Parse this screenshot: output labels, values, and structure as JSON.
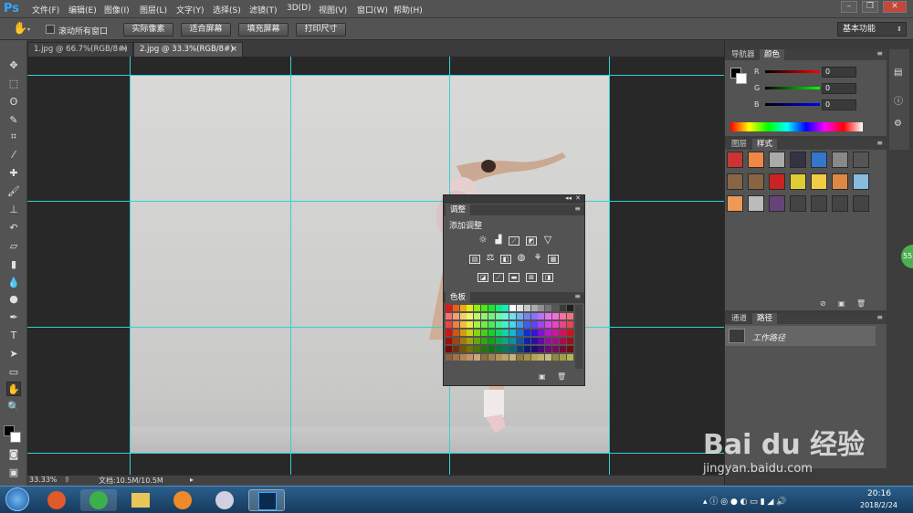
{
  "app": {
    "logo": "Ps",
    "accent": "#31a8ff"
  },
  "menu": [
    "文件(F)",
    "编辑(E)",
    "图像(I)",
    "图层(L)",
    "文字(Y)",
    "选择(S)",
    "滤镜(T)",
    "3D(D)",
    "视图(V)",
    "窗口(W)",
    "帮助(H)"
  ],
  "window_controls": {
    "min": "–",
    "restore": "❐",
    "close": "✕"
  },
  "options": {
    "scroll_all_windows": "滚动所有窗口",
    "actual_pixels": "实际像素",
    "fit_screen": "适合屏幕",
    "fill_screen": "填充屏幕",
    "print_size": "打印尺寸",
    "workspace": "基本功能"
  },
  "doc_tabs": [
    {
      "label": "1.jpg @ 66.7%(RGB/8#)",
      "close": "×"
    },
    {
      "label": "2.jpg @ 33.3%(RGB/8#)",
      "close": "×"
    }
  ],
  "status": {
    "zoom": "33.33%",
    "doc": "文档:10.5M/10.5M"
  },
  "color_panel": {
    "tabs": [
      "导航器",
      "颜色"
    ],
    "channels": [
      {
        "label": "R",
        "value": "0"
      },
      {
        "label": "G",
        "value": "0"
      },
      {
        "label": "B",
        "value": "0"
      }
    ]
  },
  "layers_panel": {
    "tabs": [
      "图层",
      "样式"
    ]
  },
  "paths_panel": {
    "tabs": [
      "通道",
      "路径"
    ],
    "item": "工作路径"
  },
  "adjust_panel": {
    "tab": "调整",
    "title": "添加调整"
  },
  "swatches_panel": {
    "tab": "色板"
  },
  "taskbar": {
    "time": "20:16",
    "date": "2018/2/24"
  },
  "watermark": {
    "brand": "Bai du 经验",
    "url": "jingyan.baidu.com"
  },
  "side_badge": "55"
}
